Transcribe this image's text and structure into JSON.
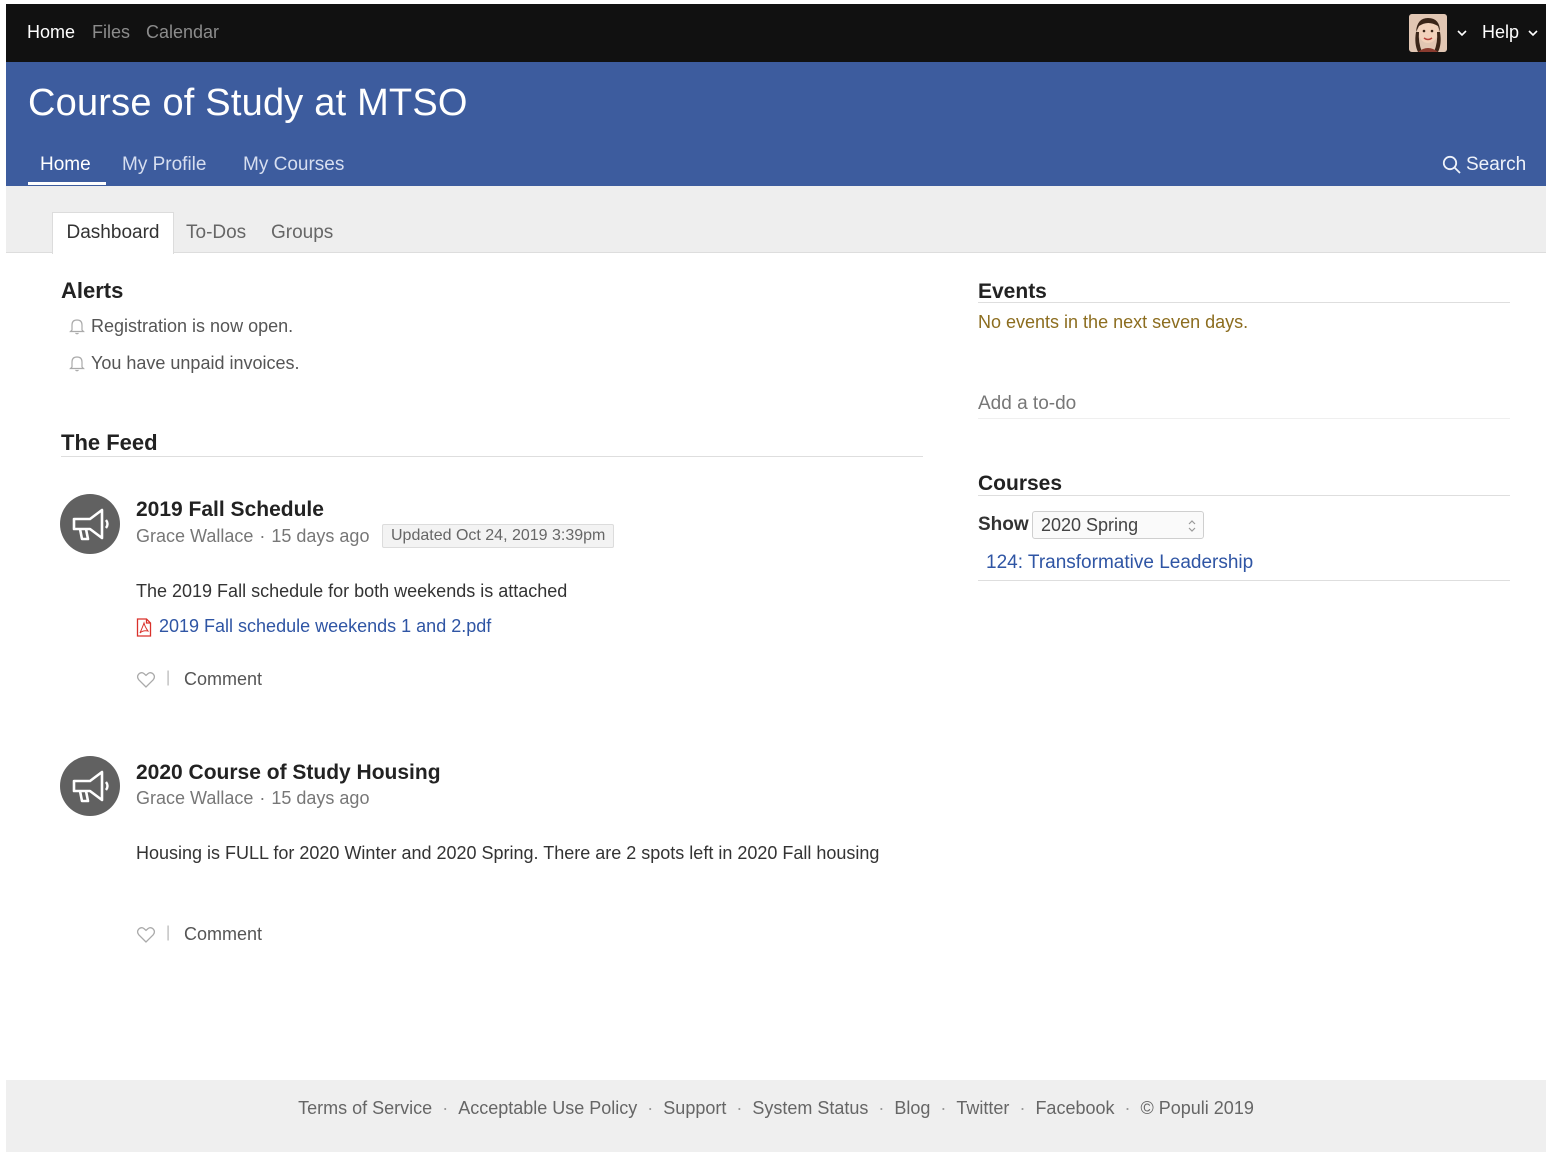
{
  "topbar": {
    "links": [
      "Home",
      "Files",
      "Calendar"
    ],
    "help_label": "Help"
  },
  "header": {
    "title": "Course of Study at MTSO",
    "nav": [
      "Home",
      "My Profile",
      "My Courses"
    ],
    "search_label": "Search"
  },
  "tabs": [
    "Dashboard",
    "To-Dos",
    "Groups"
  ],
  "alerts": {
    "heading": "Alerts",
    "items": [
      "Registration is now open.",
      "You have unpaid invoices."
    ]
  },
  "feed": {
    "heading": "The Feed",
    "posts": [
      {
        "title": "2019 Fall Schedule",
        "author": "Grace Wallace",
        "age": "15 days ago",
        "updated": "Updated Oct 24, 2019 3:39pm",
        "body": "The 2019 Fall schedule for both weekends is attached",
        "attachment": "2019 Fall schedule weekends 1 and 2.pdf",
        "comment_label": "Comment"
      },
      {
        "title": "2020 Course of Study Housing",
        "author": "Grace Wallace",
        "age": "15 days ago",
        "body": "Housing is FULL for 2020 Winter and 2020 Spring. There are 2 spots left in 2020 Fall housing",
        "comment_label": "Comment"
      }
    ]
  },
  "events": {
    "heading": "Events",
    "empty_text": "No events in the next seven days."
  },
  "todo": {
    "placeholder": "Add a to-do"
  },
  "courses": {
    "heading": "Courses",
    "show_label": "Show",
    "selected_term": "2020 Spring",
    "items": [
      "124: Transformative Leadership"
    ]
  },
  "footer": {
    "links": [
      "Terms of Service",
      "Acceptable Use Policy",
      "Support",
      "System Status",
      "Blog",
      "Twitter",
      "Facebook",
      "© Populi 2019"
    ]
  },
  "colors": {
    "topbar_bg": "#111111",
    "header_bg": "#3d5c9e",
    "link": "#2f55a4",
    "events_text": "#8c6d1f"
  }
}
